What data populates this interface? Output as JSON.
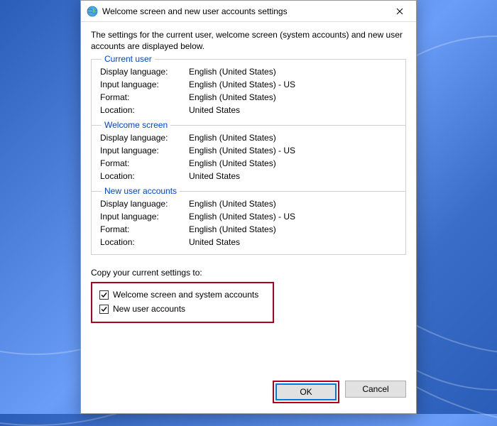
{
  "titlebar": {
    "title": "Welcome screen and new user accounts settings"
  },
  "intro": "The settings for the current user, welcome screen (system accounts) and new user accounts are displayed below.",
  "sections": {
    "current_user": {
      "legend": "Current user",
      "display_language_label": "Display language:",
      "display_language_value": "English (United States)",
      "input_language_label": "Input language:",
      "input_language_value": "English (United States) - US",
      "format_label": "Format:",
      "format_value": "English (United States)",
      "location_label": "Location:",
      "location_value": "United States"
    },
    "welcome_screen": {
      "legend": "Welcome screen",
      "display_language_label": "Display language:",
      "display_language_value": "English (United States)",
      "input_language_label": "Input language:",
      "input_language_value": "English (United States) - US",
      "format_label": "Format:",
      "format_value": "English (United States)",
      "location_label": "Location:",
      "location_value": "United States"
    },
    "new_user": {
      "legend": "New user accounts",
      "display_language_label": "Display language:",
      "display_language_value": "English (United States)",
      "input_language_label": "Input language:",
      "input_language_value": "English (United States) - US",
      "format_label": "Format:",
      "format_value": "English (United States)",
      "location_label": "Location:",
      "location_value": "United States"
    }
  },
  "copy": {
    "label": "Copy your current settings to:",
    "welcome_checkbox_label": "Welcome screen and system accounts",
    "welcome_checked": true,
    "newuser_checkbox_label": "New user accounts",
    "newuser_checked": true
  },
  "buttons": {
    "ok": "OK",
    "cancel": "Cancel"
  }
}
